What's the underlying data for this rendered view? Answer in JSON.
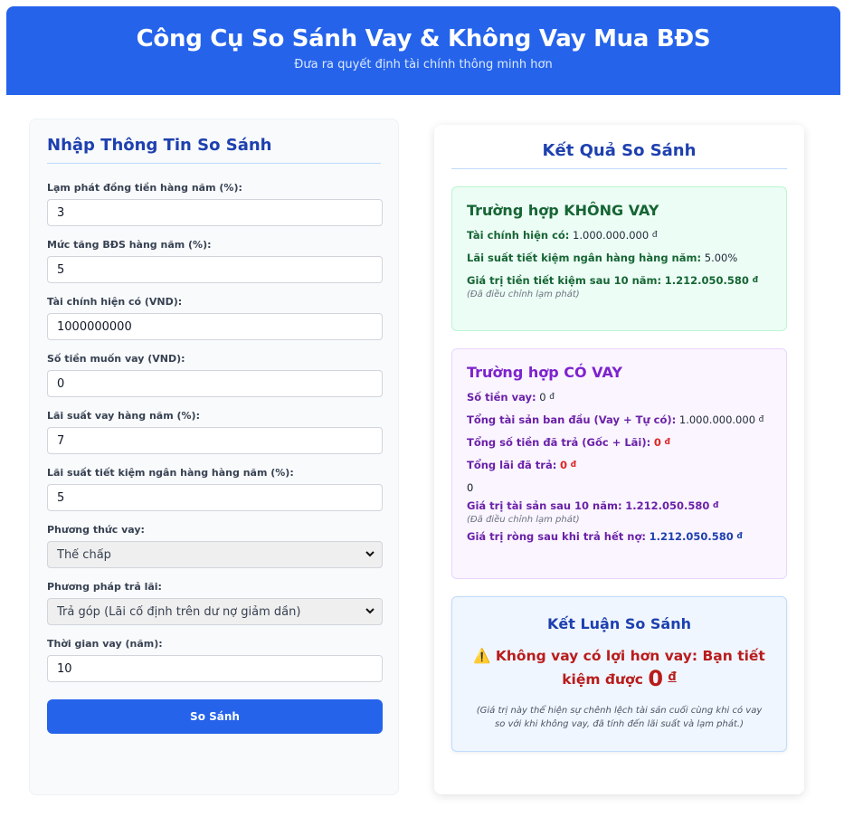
{
  "header": {
    "title": "Công Cụ So Sánh Vay & Không Vay Mua BĐS",
    "subtitle": "Đưa ra quyết định tài chính thông minh hơn"
  },
  "form": {
    "title": "Nhập Thông Tin So Sánh",
    "inflation": {
      "label": "Lạm phát đồng tiền hàng năm (%):",
      "value": "3"
    },
    "property_growth": {
      "label": "Mức tăng BĐS hàng năm (%):",
      "value": "5"
    },
    "current_funds": {
      "label": "Tài chính hiện có (VND):",
      "value": "1000000000"
    },
    "loan_amount": {
      "label": "Số tiền muốn vay (VND):",
      "value": "0"
    },
    "loan_rate": {
      "label": "Lãi suất vay hàng năm (%):",
      "value": "7"
    },
    "savings_rate": {
      "label": "Lãi suất tiết kiệm ngân hàng hàng năm (%):",
      "value": "5"
    },
    "loan_method": {
      "label": "Phương thức vay:",
      "selected": "Thế chấp"
    },
    "repayment_method": {
      "label": "Phương pháp trả lãi:",
      "selected": "Trả góp (Lãi cố định trên dư nợ giảm dần)"
    },
    "loan_term": {
      "label": "Thời gian vay (năm):",
      "value": "10"
    },
    "submit_label": "So Sánh"
  },
  "results": {
    "title": "Kết Quả So Sánh",
    "currency": "đ",
    "no_loan": {
      "title": "Trường hợp KHÔNG VAY",
      "funds_label": "Tài chính hiện có:",
      "funds_value": "1.000.000.000",
      "rate_label": "Lãi suất tiết kiệm ngân hàng hàng năm:",
      "rate_value": "5.00%",
      "savings_label": "Giá trị tiền tiết kiệm sau 10 năm:",
      "savings_value": "1.212.050.580",
      "note": "(Đã điều chỉnh lạm phát)"
    },
    "with_loan": {
      "title": "Trường hợp CÓ VAY",
      "loan_label": "Số tiền vay:",
      "loan_value": "0",
      "initial_label": "Tổng tài sản ban đầu (Vay + Tự có):",
      "initial_value": "1.000.000.000",
      "total_paid_label": "Tổng số tiền đã trả (Gốc + Lãi):",
      "total_paid_value": "0",
      "interest_label": "Tổng lãi đã trả:",
      "interest_value": "0",
      "extra_value": "0",
      "asset_label": "Giá trị tài sản sau 10 năm:",
      "asset_value": "1.212.050.580",
      "note": "(Đã điều chỉnh lạm phát)",
      "net_label": "Giá trị ròng sau khi trả hết nợ:",
      "net_value": "1.212.050.580"
    },
    "conclusion": {
      "title": "Kết Luận So Sánh",
      "icon": "⚠️",
      "message": "Không vay có lợi hơn vay: Bạn tiết kiệm được",
      "amount": "0",
      "note": "(Giá trị này thể hiện sự chênh lệch tài sản cuối cùng khi có vay so với khi không vay, đã tính đến lãi suất và lạm phát.)"
    }
  },
  "colors": {
    "primary": "#2563eb",
    "green": "#166534",
    "purple": "#7e22ce",
    "red": "#dc2626"
  }
}
